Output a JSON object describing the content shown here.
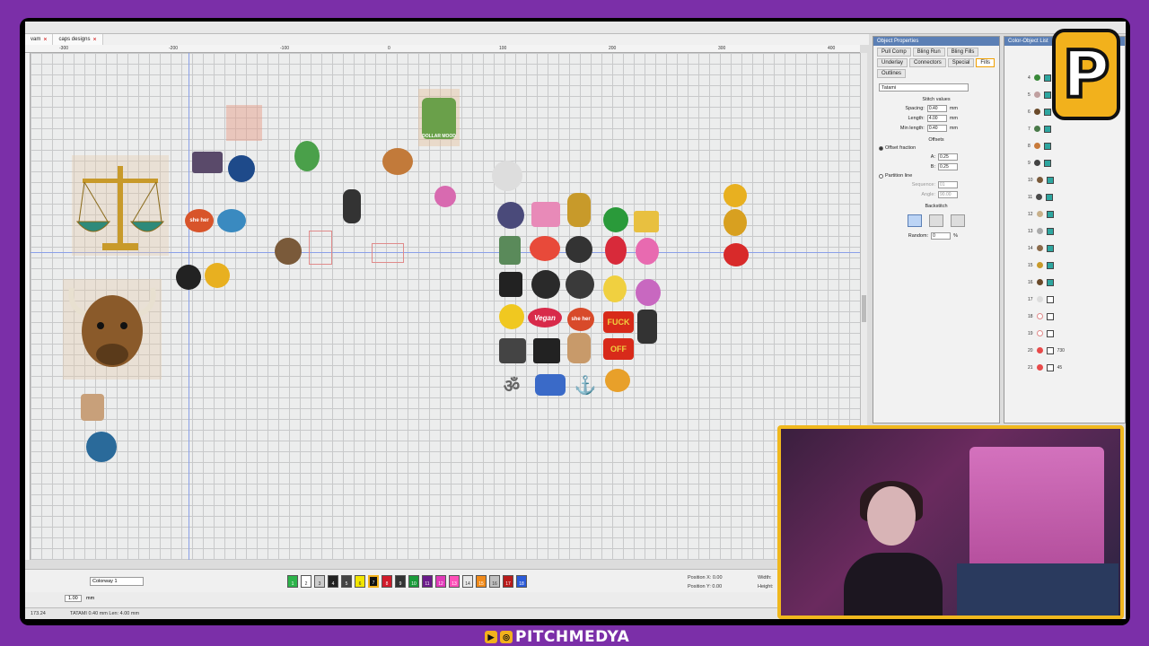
{
  "tabs": [
    {
      "label": "vam"
    },
    {
      "label": "caps designs"
    }
  ],
  "ruler_ticks": [
    "-300",
    "-200",
    "-100",
    "0",
    "100",
    "200",
    "300",
    "400"
  ],
  "canvas": {
    "patch_labels": {
      "she_her": "she her",
      "vegan": "Vegan",
      "fuck": "FUCK",
      "off": "OFF",
      "dollar": "DOLLAR MOOD",
      "om": "ॐ"
    }
  },
  "object_properties": {
    "title": "Object Properties",
    "tabs": [
      "Pull Comp",
      "Bling Run",
      "Bling Fills",
      "Underlay",
      "Connectors",
      "Special",
      "Fills",
      "Outlines"
    ],
    "active_tab": "Fills",
    "fill_type": "Tatami",
    "stitch_values_label": "Stitch values",
    "spacing": {
      "label": "Spacing:",
      "value": "0.40",
      "unit": "mm"
    },
    "length": {
      "label": "Length:",
      "value": "4.00",
      "unit": "mm"
    },
    "min_length": {
      "label": "Min length:",
      "value": "0.40",
      "unit": "mm"
    },
    "offsets_label": "Offsets",
    "offset_fraction": "Offset fraction",
    "a": {
      "label": "A:",
      "value": "0.25"
    },
    "b": {
      "label": "B:",
      "value": "0.25"
    },
    "partition_line": "Partition line",
    "sequence": {
      "label": "Sequence:",
      "value": "01"
    },
    "angle": {
      "label": "Angle:",
      "value": "90.00"
    },
    "backstitch_label": "Backstitch",
    "random": {
      "label": "Random:",
      "value": "0",
      "unit": "%"
    }
  },
  "color_object_list": {
    "title": "Color-Object List",
    "rows": [
      "4",
      "5",
      "6",
      "7",
      "8",
      "9",
      "10",
      "11",
      "12",
      "13",
      "14",
      "15",
      "16",
      "17",
      "18",
      "19",
      "20",
      "21"
    ],
    "row_values": {
      "20": "730",
      "21": "45"
    }
  },
  "bottom_toolbar": {
    "colorway": "Colorway 1",
    "palette": [
      {
        "num": "1",
        "color": "#2db34a"
      },
      {
        "num": "2",
        "color": "#ffffff"
      },
      {
        "num": "3",
        "color": "#cccccc"
      },
      {
        "num": "4",
        "color": "#222222"
      },
      {
        "num": "5",
        "color": "#444444"
      },
      {
        "num": "6",
        "color": "#f2e600"
      },
      {
        "num": "7",
        "color": "#111111"
      },
      {
        "num": "8",
        "color": "#d11a2a"
      },
      {
        "num": "9",
        "color": "#333333"
      },
      {
        "num": "10",
        "color": "#1a9a3a"
      },
      {
        "num": "11",
        "color": "#6a1a8a"
      },
      {
        "num": "12",
        "color": "#e03ab8"
      },
      {
        "num": "13",
        "color": "#ff4fb8"
      },
      {
        "num": "14",
        "color": "#e8e8e8"
      },
      {
        "num": "15",
        "color": "#f08a1a"
      },
      {
        "num": "16",
        "color": "#c0c0c0"
      },
      {
        "num": "17",
        "color": "#b81a1a"
      },
      {
        "num": "18",
        "color": "#2a5ad8"
      }
    ],
    "position_x": {
      "label": "Position X:",
      "value": "0.00"
    },
    "position_y": {
      "label": "Position Y:",
      "value": "0.00"
    },
    "width_label": "Width:",
    "height_label": "Height:",
    "zoom_value": "1.00",
    "zoom_unit": "mm"
  },
  "status": {
    "coords": "173.24",
    "text": "TATAMI  0.40 mm Len: 4.00 mm"
  },
  "branding": {
    "logo_letter": "P",
    "footer_text": "PITCHMEDYA"
  }
}
